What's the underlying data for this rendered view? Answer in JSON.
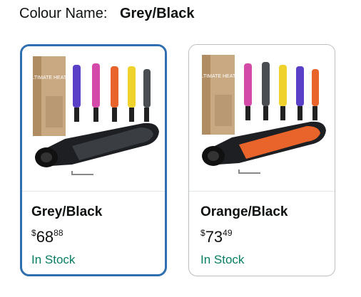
{
  "colour_selector": {
    "label": "Colour Name:",
    "selected_value": "Grey/Black"
  },
  "options": [
    {
      "name": "Grey/Black",
      "price_symbol": "$",
      "price_whole": "68",
      "price_fraction": "88",
      "availability": "In Stock",
      "selected": true,
      "gun_color": "#3a3d42",
      "image_text": "ULTIMATE HEAT GUN"
    },
    {
      "name": "Orange/Black",
      "price_symbol": "$",
      "price_whole": "73",
      "price_fraction": "49",
      "availability": "In Stock",
      "selected": false,
      "gun_color": "#e8642a",
      "image_text": "ULTIMATE HEAT GUN"
    }
  ],
  "colors": {
    "selected_border": "#2f6fb0",
    "stock_green": "#067d62"
  }
}
